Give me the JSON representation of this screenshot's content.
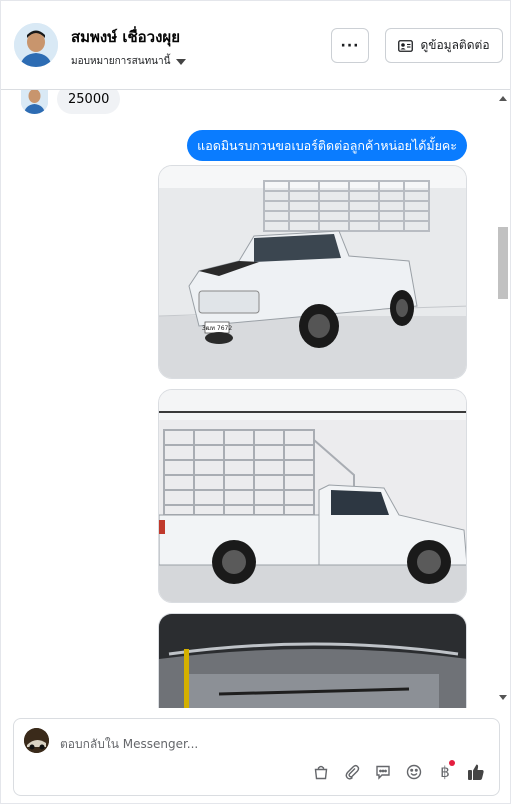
{
  "header": {
    "contact_name": "สมพงษ์ เชื่อวงผุย",
    "assignment_label": "มอบหมายการสนทนานี้",
    "more_label": "···",
    "contact_info_label": "ดูข้อมูลติดต่อ"
  },
  "messages": {
    "incoming_text": "25000",
    "outgoing_text": "แอดมินรบกวนขอเบอร์ติดต่อลูกค้าหน่อยได้มั้ยคะ"
  },
  "photos": {
    "plate_text": "3ฒท 7672"
  },
  "composer": {
    "placeholder": "ตอบกลับใน Messenger...",
    "currency_symbol": "฿"
  },
  "colors": {
    "accent": "#0a7cff",
    "incoming_bubble": "#f0f2f5",
    "notification_dot": "#e41e3f"
  },
  "icons": [
    "more-icon",
    "contact-card-icon",
    "chevron-down-icon",
    "bag-icon",
    "attachment-icon",
    "saved-reply-icon",
    "emoji-icon",
    "currency-icon",
    "thumbs-up-icon"
  ]
}
